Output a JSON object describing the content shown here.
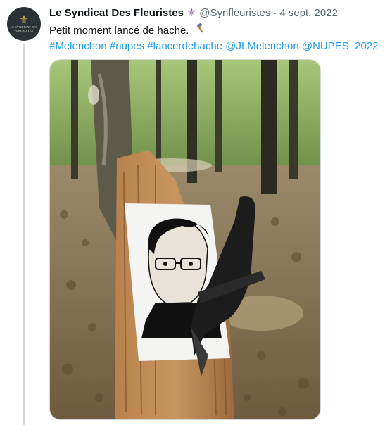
{
  "tweet": {
    "author_name": "Le Syndicat Des Fleuristes",
    "verified_icon": "fleur-de-lis-icon",
    "handle": "@Synfleuristes",
    "separator": "·",
    "date": "4 sept. 2022",
    "text": "Petit moment lancé de hache.",
    "text_emoji": "hammer-icon",
    "hashtags": [
      "#Melenchon",
      "#nupes",
      "#lancerdehache",
      "@JLMelenchon",
      "@NUPES_2022_"
    ]
  },
  "avatar": {
    "line1": "LE SYNDICAT DES",
    "line2": "FLEURISTES"
  },
  "colors": {
    "link": "#1d9bf0",
    "muted": "#536471",
    "text": "#0f1419",
    "thread_line": "#cfd9de"
  },
  "media": {
    "description_icon": "photo-image"
  }
}
